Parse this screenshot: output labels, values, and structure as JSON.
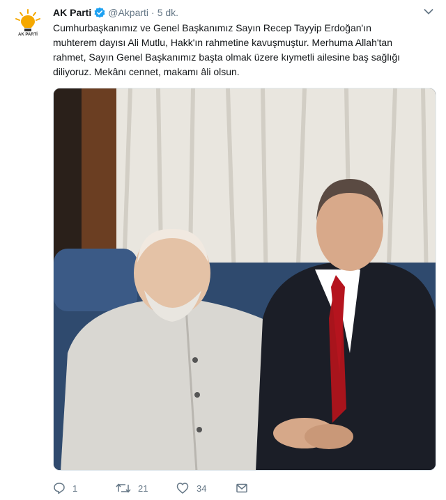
{
  "tweet": {
    "author_name": "AK Parti",
    "handle": "@Akparti",
    "separator": "·",
    "time": "5 dk.",
    "avatar_caption": "AK PARTİ",
    "text_lines": [
      "Cumhurbaşkanımız ve Genel Başkanımız Sayın Recep Tayyip Erdoğan'ın",
      "muhterem dayısı Ali Mutlu, Hakk'ın rahmetine kavuşmuştur. Merhuma Allah'tan",
      "rahmet, Sayın Genel Başkanımız başta olmak üzere kıymetli ailesine baş sağlığı",
      "diliyoruz. Mekânı cennet, makamı âli olsun."
    ],
    "replies": "1",
    "retweets": "21",
    "likes": "34"
  },
  "colors": {
    "accent": "#1da1f2",
    "muted": "#657786",
    "logo_yellow": "#f5a800"
  },
  "icons": [
    "verified-badge-icon",
    "chevron-down-icon",
    "reply-icon",
    "retweet-icon",
    "like-icon",
    "message-icon"
  ]
}
